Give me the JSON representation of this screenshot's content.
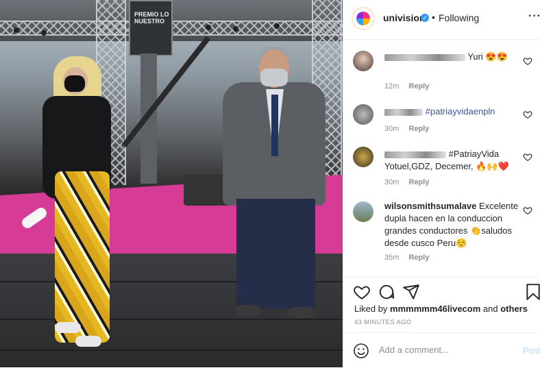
{
  "header": {
    "username": "univision",
    "separator": "•",
    "follow_status": "Following",
    "more_icon": "more-horizontal-icon"
  },
  "comments": [
    {
      "username": "",
      "text": "Yuri 😍😍",
      "time": "12m",
      "reply": "Reply"
    },
    {
      "username": "",
      "text": "#patriayvidaenpln",
      "time": "30m",
      "reply": "Reply"
    },
    {
      "username": "",
      "text": "#PatriayVida Yotuel,GDZ, Decemer, 🔥🙌❤️",
      "time": "30m",
      "reply": "Reply"
    },
    {
      "username": "wilsonsmithsumalave",
      "text": "Excelente dupla hacen en la conduccion grandes conductores 👏saludos desde cusco Peru☺️",
      "time": "35m",
      "reply": "Reply"
    }
  ],
  "actions": {
    "liked_prefix": "Liked by",
    "liked_user": "mmmmmm46livecom",
    "liked_and": "and",
    "liked_others": "others",
    "timestamp": "43 MINUTES AGO"
  },
  "add_comment": {
    "placeholder": "Add a comment...",
    "post_label": "Post"
  },
  "photo": {
    "sign_text": "PREMIO LO NUESTRO"
  },
  "colors": {
    "link": "#385898",
    "muted": "#8e8e8e",
    "post_disabled": "#b3dbff",
    "verified": "#3897f0"
  }
}
